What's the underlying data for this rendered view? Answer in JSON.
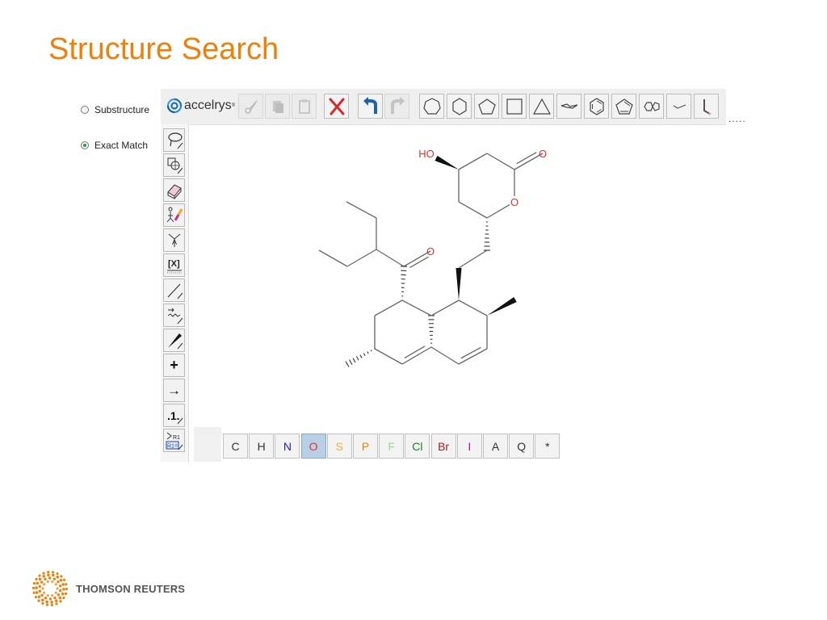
{
  "slide": {
    "title": "Structure Search"
  },
  "search_mode": {
    "options": [
      {
        "label": "Substructure",
        "checked": false
      },
      {
        "label": "Exact Match",
        "checked": true
      }
    ]
  },
  "editor": {
    "brand": "accelrys",
    "top_toolbar": [
      {
        "name": "cut",
        "icon": "scissors-icon",
        "enabled": false
      },
      {
        "name": "copy",
        "icon": "copy-icon",
        "enabled": false
      },
      {
        "name": "paste",
        "icon": "paste-icon",
        "enabled": false
      },
      {
        "name": "delete",
        "icon": "delete-x-icon",
        "enabled": true
      },
      {
        "name": "undo",
        "icon": "undo-icon",
        "enabled": true
      },
      {
        "name": "redo",
        "icon": "redo-icon",
        "enabled": false
      },
      {
        "name": "cycloheptane",
        "icon": "heptagon-icon",
        "enabled": true
      },
      {
        "name": "cyclohexane",
        "icon": "hexagon-icon",
        "enabled": true
      },
      {
        "name": "cyclopentane",
        "icon": "pentagon-icon",
        "enabled": true
      },
      {
        "name": "cyclobutane",
        "icon": "square-icon",
        "enabled": true
      },
      {
        "name": "cyclopropane",
        "icon": "triangle-icon",
        "enabled": true
      },
      {
        "name": "chair-cyclohexane",
        "icon": "chair-icon",
        "enabled": true
      },
      {
        "name": "benzene",
        "icon": "benzene-icon",
        "enabled": true
      },
      {
        "name": "cyclopentadiene",
        "icon": "cyclopentadiene-icon",
        "enabled": true
      },
      {
        "name": "fused-ring",
        "icon": "fused-ring-icon",
        "enabled": true
      },
      {
        "name": "chain",
        "icon": "chain-icon",
        "enabled": true
      },
      {
        "name": "bond-template",
        "icon": "bond-template-icon",
        "enabled": true
      }
    ],
    "overflow_indicator": ".....",
    "left_toolbar": [
      {
        "name": "lasso-select",
        "icon": "lasso-icon"
      },
      {
        "name": "rotate",
        "icon": "rotate-icon"
      },
      {
        "name": "eraser",
        "icon": "eraser-icon"
      },
      {
        "name": "atom-color",
        "icon": "atom-pencil-icon"
      },
      {
        "name": "atom-query",
        "icon": "atom-query-icon"
      },
      {
        "name": "bracket",
        "icon": "bracket-icon",
        "label": "[X]"
      },
      {
        "name": "single-bond",
        "icon": "single-bond-icon"
      },
      {
        "name": "reaction-bond",
        "icon": "reaction-bond-icon"
      },
      {
        "name": "wedge-bond",
        "icon": "wedge-bond-icon"
      },
      {
        "name": "plus",
        "icon": "plus-icon",
        "label": "+"
      },
      {
        "name": "reaction-arrow",
        "icon": "arrow-icon",
        "label": "→"
      },
      {
        "name": "atom-map",
        "icon": "atom-map-icon",
        "label": ".1."
      },
      {
        "name": "r-group",
        "icon": "r-group-icon",
        "label": "R1"
      }
    ],
    "element_bar": [
      {
        "symbol": "C",
        "color": "#333333",
        "selected": false
      },
      {
        "symbol": "H",
        "color": "#333333",
        "selected": false
      },
      {
        "symbol": "N",
        "color": "#2020c0",
        "selected": false
      },
      {
        "symbol": "O",
        "color": "#e03030",
        "selected": true
      },
      {
        "symbol": "S",
        "color": "#f0b030",
        "selected": false
      },
      {
        "symbol": "P",
        "color": "#f07f0a",
        "selected": false
      },
      {
        "symbol": "F",
        "color": "#90e090",
        "selected": false
      },
      {
        "symbol": "Cl",
        "color": "#208020",
        "selected": false
      },
      {
        "symbol": "Br",
        "color": "#a02020",
        "selected": false
      },
      {
        "symbol": "I",
        "color": "#a020a0",
        "selected": false
      },
      {
        "symbol": "A",
        "color": "#333333",
        "selected": false
      },
      {
        "symbol": "Q",
        "color": "#333333",
        "selected": false
      },
      {
        "symbol": "*",
        "color": "#333333",
        "selected": false
      }
    ],
    "molecule": {
      "labels": {
        "hydroxyl": "HO",
        "lactone_carbonyl_o": "O",
        "ring_o": "O",
        "ester_carbonyl_o": "O"
      },
      "heteroatom_color": "#e03030",
      "bond_color": "#666666"
    }
  },
  "footer": {
    "brand": "THOMSON REUTERS",
    "brand_color": "#f07f0a"
  }
}
